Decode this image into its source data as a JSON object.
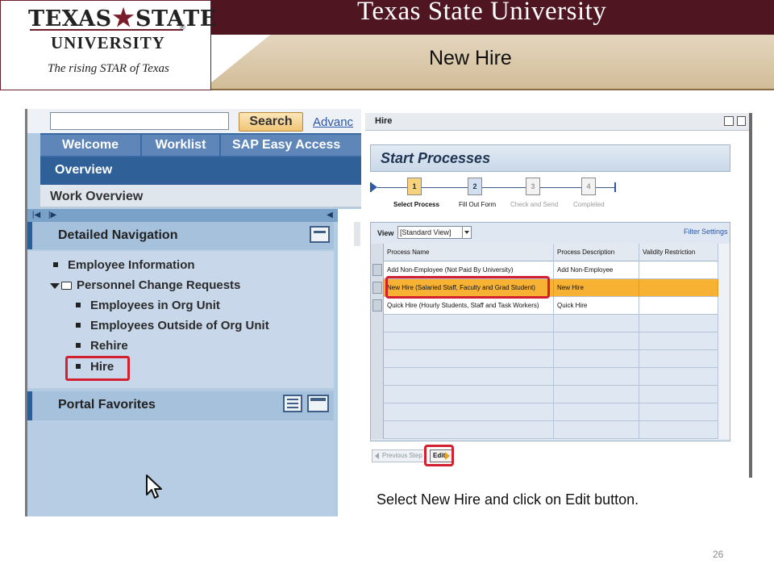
{
  "header": {
    "logo_word1": "TEXAS",
    "logo_word2": "STATE",
    "logo_reg": "®",
    "logo_university": "UNIVERSITY",
    "logo_tagline": "The rising STAR of Texas",
    "university_title": "Texas State University",
    "slide_title": "New Hire",
    "star_glyph": "★"
  },
  "portal": {
    "search_placeholder": "",
    "search_button": "Search",
    "advanced_link": "Advanc",
    "tabs": [
      "Welcome",
      "Worklist",
      "SAP Easy Access"
    ],
    "overview": "Overview",
    "work_overview": "Work Overview",
    "nav_tools": [
      "|◀",
      "|▶",
      "◀"
    ],
    "detailed_navigation": "Detailed Navigation",
    "nav_items": [
      "Employee Information",
      "Personnel Change Requests",
      "Employees in Org Unit",
      "Employees Outside of Org Unit",
      "Rehire",
      "Hire"
    ],
    "portal_favorites": "Portal Favorites"
  },
  "process_window": {
    "title": "Hire",
    "start_processes": "Start Processes",
    "roadmap": [
      {
        "num": "1",
        "label": "Select Process",
        "state": "active"
      },
      {
        "num": "2",
        "label": "Fill Out Form",
        "state": "next"
      },
      {
        "num": "3",
        "label": "Check and Send",
        "state": "disabled"
      },
      {
        "num": "4",
        "label": "Completed",
        "state": "disabled"
      }
    ],
    "view_label": "View",
    "view_value": "[Standard View]",
    "filter_link": "Filter",
    "settings_link": "Settings",
    "columns": [
      "Process Name",
      "Process Description",
      "Validity Restriction"
    ],
    "rows": [
      {
        "name": "Add Non-Employee (Not Paid By University)",
        "desc": "Add Non-Employee",
        "valid": ""
      },
      {
        "name": "New Hire (Salaried Staff, Faculty and Grad Student)",
        "desc": "New Hire",
        "valid": ""
      },
      {
        "name": "Quick Hire (Hourly Students, Staff and Task Workers)",
        "desc": "Quick Hire",
        "valid": ""
      }
    ],
    "empty_row_count": 7,
    "previous_step": "Previous Step",
    "edit": "Edit"
  },
  "caption": "Select New Hire and click on Edit button.",
  "page_number": "26",
  "colors": {
    "maroon": "#4f1521",
    "gold": "#d2bc96",
    "highlight_red": "#d22030",
    "selected_row": "#f7b234",
    "sap_blue": "#2f6098"
  }
}
